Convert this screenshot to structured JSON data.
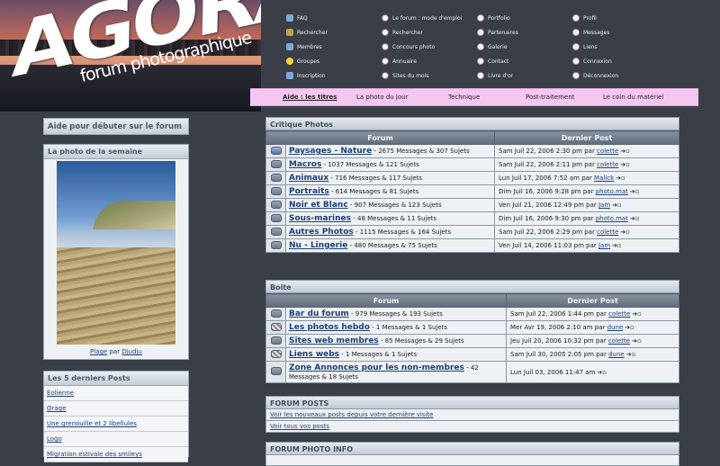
{
  "logo": {
    "title": "AGORA",
    "subtitle": "forum photographique"
  },
  "topnav": [
    {
      "label": "FAQ",
      "icon": "star-icon"
    },
    {
      "label": "Rechercher",
      "icon": "key-icon"
    },
    {
      "label": "Membres",
      "icon": "star-icon"
    },
    {
      "label": "Groupes",
      "icon": "smile-icon"
    },
    {
      "label": "Inscription",
      "icon": "star-icon"
    },
    {
      "label": "Le forum : mode d'emploi",
      "icon": "pen-icon"
    },
    {
      "label": "Rechercher",
      "icon": "pen-icon"
    },
    {
      "label": "Concours photo",
      "icon": "pen-icon"
    },
    {
      "label": "Annuaire",
      "icon": "pen-icon"
    },
    {
      "label": "Sites du mois",
      "icon": "pen-icon"
    },
    {
      "label": "Portfolio",
      "icon": "circle-icon"
    },
    {
      "label": "Partenaires",
      "icon": "circle-icon"
    },
    {
      "label": "Galerie",
      "icon": "circle-icon"
    },
    {
      "label": "Contact",
      "icon": "circle-icon"
    },
    {
      "label": "Livre d'or",
      "icon": "circle-icon"
    },
    {
      "label": "Profil",
      "icon": "circle-icon"
    },
    {
      "label": "Messages",
      "icon": "circle-icon"
    },
    {
      "label": "Liens",
      "icon": "circle-icon"
    },
    {
      "label": "Connexion",
      "icon": "circle-icon"
    },
    {
      "label": "Déconnexion",
      "icon": "circle-icon"
    }
  ],
  "pinkbar": [
    "Aide : les titres",
    "La photo du jour",
    "Technique",
    "Post-traitement",
    "Le coin du matériel"
  ],
  "sidebar": {
    "help_label": "Aide pour débuter sur le forum",
    "photo_title": "La photo de la semaine",
    "photo_name": "Plage",
    "photo_by": "par",
    "photo_author": "Djudju",
    "last_title": "Les 5 derniers Posts",
    "last_posts": [
      "Eolienne",
      "Orage",
      "Une grenouille et 2 libellules",
      "Logo",
      "Migration estivale des smileys"
    ]
  },
  "critique": {
    "title": "Critique Photos",
    "col_forum": "Forum",
    "col_last": "Dernier Post",
    "rows": [
      {
        "name": "Paysages - Nature",
        "stats": "- 2675 Messages & 307 Sujets",
        "date": "Sam Juil 22, 2006 2:30 pm",
        "by": "par",
        "user": "colette",
        "state": "new"
      },
      {
        "name": "Macros",
        "stats": "- 1037 Messages & 121 Sujets",
        "date": "Sam Juil 22, 2006 2:11 pm",
        "by": "par",
        "user": "colette",
        "state": "normal"
      },
      {
        "name": "Animaux",
        "stats": "- 716 Messages & 117 Sujets",
        "date": "Lun Juil 17, 2006 7:52 am",
        "by": "par",
        "user": "Malick",
        "state": "normal"
      },
      {
        "name": "Portraits",
        "stats": "- 614 Messages & 81 Sujets",
        "date": "Dim Juil 16, 2006 9:28 pm",
        "by": "par",
        "user": "photo.mat",
        "state": "normal"
      },
      {
        "name": "Noir et Blanc",
        "stats": "- 907 Messages & 123 Sujets",
        "date": "Ven Juil 21, 2006 12:49 pm",
        "by": "par",
        "user": "Jam",
        "state": "normal"
      },
      {
        "name": "Sous-marines",
        "stats": "- 48 Messages & 11 Sujets",
        "date": "Dim Juil 16, 2006 9:30 pm",
        "by": "par",
        "user": "photo.mat",
        "state": "normal"
      },
      {
        "name": "Autres Photos",
        "stats": "- 1115 Messages & 164 Sujets",
        "date": "Sam Juil 22, 2006 2:29 pm",
        "by": "par",
        "user": "colette",
        "state": "normal"
      },
      {
        "name": "Nu - Lingerie",
        "stats": "- 480 Messages & 75 Sujets",
        "date": "Ven Juil 14, 2006 11:03 pm",
        "by": "par",
        "user": "Jam",
        "state": "normal"
      }
    ]
  },
  "boite": {
    "title": "Boite",
    "col_forum": "Forum",
    "col_last": "Dernier Post",
    "rows": [
      {
        "name": "Bar du forum",
        "stats": "- 979 Messages & 193 Sujets",
        "date": "Sam Juil 22, 2006 1:44 pm",
        "by": "par",
        "user": "colette",
        "state": "normal"
      },
      {
        "name": "Les photos hebdo",
        "stats": "- 1 Messages & 1 Sujets",
        "date": "Mer Avr 19, 2006 2:10 am",
        "by": "par",
        "user": "dune",
        "state": "locked"
      },
      {
        "name": "Sites web membres",
        "stats": "- 85 Messages & 29 Sujets",
        "date": "Jeu Juil 20, 2006 10:32 pm",
        "by": "par",
        "user": "colette",
        "state": "normal"
      },
      {
        "name": "Liens webs",
        "stats": "- 1 Messages & 1 Sujets",
        "date": "Sam Juil 30, 2005 2:05 pm",
        "by": "par",
        "user": "dune",
        "state": "locked"
      },
      {
        "name": "Zone Annonces pour les non-membres",
        "stats": "- 42 Messages & 18 Sujets",
        "date": "Lun Juil 03, 2006 11:47 am",
        "by": "",
        "user": "",
        "state": "normal"
      }
    ]
  },
  "forum_posts": {
    "title": "FORUM POSTS",
    "links": [
      "Voir les nouveaux posts depuis votre dernière visite",
      "Voir tous vos posts"
    ]
  },
  "photo_info": {
    "title": "FORUM PHOTO INFO"
  }
}
